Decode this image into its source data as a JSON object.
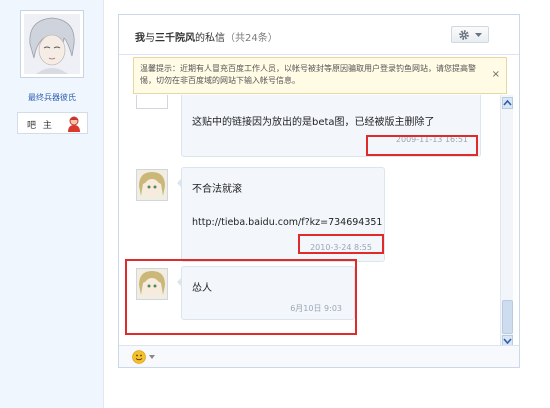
{
  "profile": {
    "username": "最终兵器彼氏",
    "owner_label": "吧 主"
  },
  "panel": {
    "title_me": "我",
    "title_with": "与",
    "title_other": "三千院风",
    "title_suffix": "的私信",
    "count": "（共24条）"
  },
  "notice": {
    "text": "温馨提示：近期有人冒充百度工作人员，以帐号被封等原因骗取用户登录钓鱼网站，请您提高警惕，切勿在非百度域的网站下输入帐号信息。",
    "close": "×"
  },
  "messages": [
    {
      "text": "这贴中的链接因为放出的是beta图，已经被版主删除了",
      "time": "2009-11-13 16:51"
    },
    {
      "text": "不合法就滚",
      "text2": "http://tieba.baidu.com/f?kz=734694351",
      "time": "2010-3-24 8:55"
    },
    {
      "text": "怂人",
      "time": "6月10日 9:03"
    }
  ],
  "icons": {
    "settings": "gear-icon",
    "dropdown": "chevron-down-icon",
    "emoji": "smiley-icon",
    "owner": "user-icon"
  },
  "colors": {
    "highlight": "#e02b2b",
    "link_blue": "#2c5fb3"
  }
}
